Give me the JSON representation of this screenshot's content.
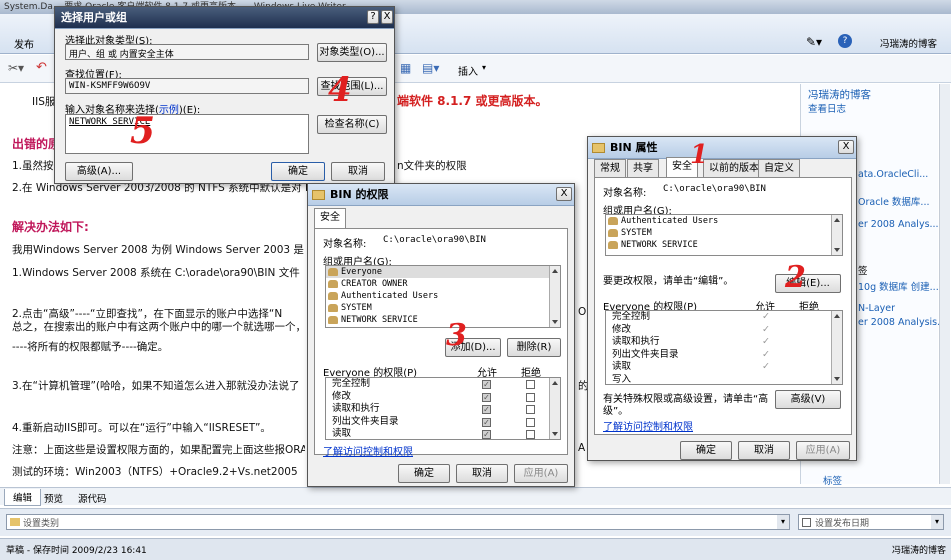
{
  "app": {
    "titlebar": "System.Da...                 要求 Oracle 客户端软件 8.1.7 或更高版本。 - Windows Live Writer",
    "publish": "发布",
    "insert": "插入",
    "blog_name": "冯瑞涛的博客",
    "status": "草稿 - 保存时间 2009/2/23 16:41",
    "status_user": "冯瑞涛的博客"
  },
  "document": {
    "iis": "IIS服",
    "headline_red": "端软件 8.1.7 或更高版本。",
    "err_head": "出错的原",
    "l1": "1.虽然按",
    "l1b": "n文件夹的权限",
    "l2": "2.在  Windows Server 2003/2008 的 NTFS 系统中默认是对 IUSR 账号权限的限制，因此我们没有权限访问该目录",
    "sol_head": "解决办法如下:",
    "p1": "我用Windows Server 2008 为例 Windows Server 2003 是",
    "p2": "1.Windows Server 2008 系统在  C:\\orade\\ora90\\BIN 文件",
    "p3": "2.点击“高级”----“立即查找”，在下面显示的账户中选择“N",
    "p3b": "总之，在搜索出的账户中有这两个账户中的哪一个就选哪一个，回",
    "p4": "----将所有的权限都赋予----确定。",
    "p5": "3.在“计算机管理”(哈哈，如果不知道怎么进入那就没办法说了",
    "p5b": "的",
    "p6": "4.重新启动IIS即可。可以在“运行”中输入“IISRESET”。",
    "p7": "注意：上面这些是设置权限方面的，如果配置完上面这些报ORA-",
    "p8": "测试的环境：Win2003（NTFS）+Oracle9.2+Vs.net2005",
    "frag_or": "OR",
    "frag_a": "A"
  },
  "sidebar": {
    "blog": "冯瑞涛的博客",
    "view_log": "查看日志",
    "items": [
      "ata.OracleCli...",
      "Oracle 数据库...",
      "er 2008 Analys...",
      "签",
      "10g 数据库 创建...",
      "N-Layer",
      "er 2008 Analysis...",
      "标签"
    ]
  },
  "bottom": {
    "tabs": [
      "编辑",
      "预览",
      "源代码"
    ],
    "category": "设置类别",
    "date": "设置发布日期"
  },
  "select_dlg": {
    "title": "选择用户或组",
    "help": "?",
    "close": "X",
    "obj_type_label": "选择此对象类型(S):",
    "obj_type_value": "用户、组 或 内置安全主体",
    "obj_type_btn": "对象类型(O)...",
    "loc_label": "查找位置(F):",
    "loc_value": "WIN-KSMFF9W6O9V",
    "loc_btn": "查找范围(L)...",
    "name_label": "输入对象名称来选择(",
    "name_link": "示例",
    "name_label_end": ")(E):",
    "name_value": "NETWORK SERVICE",
    "check_btn": "检查名称(C)",
    "adv_btn": "高级(A)...",
    "ok": "确定",
    "cancel": "取消"
  },
  "bin_perm": {
    "title": "BIN 的权限",
    "close": "X",
    "tab": "安全",
    "obj_label": "对象名称:",
    "obj_value": "C:\\oracle\\ora90\\BIN",
    "group_label": "组或用户名(G):",
    "users": [
      "Everyone",
      "CREATOR OWNER",
      "Authenticated Users",
      "SYSTEM",
      "NETWORK SERVICE"
    ],
    "add": "添加(D)...",
    "remove": "删除(R)",
    "perm_label": "Everyone 的权限(P)",
    "allow": "允许",
    "deny": "拒绝",
    "perms": [
      "完全控制",
      "修改",
      "读取和执行",
      "列出文件夹目录",
      "读取"
    ],
    "link": "了解访问控制和权限",
    "ok": "确定",
    "cancel": "取消",
    "apply": "应用(A)"
  },
  "bin_prop": {
    "title": "BIN 属性",
    "close": "X",
    "tabs": [
      "常规",
      "共享",
      "安全",
      "以前的版本",
      "自定义"
    ],
    "obj_label": "对象名称:",
    "obj_value": "C:\\oracle\\ora90\\BIN",
    "group_label": "组或用户名(G):",
    "users": [
      "Authenticated Users",
      "SYSTEM",
      "NETWORK SERVICE"
    ],
    "change_text": "要更改权限，请单击“编辑”。",
    "edit": "编辑(E)...",
    "perm_label": "Everyone 的权限(P)",
    "allow": "允许",
    "deny": "拒绝",
    "perms": [
      "完全控制",
      "修改",
      "读取和执行",
      "列出文件夹目录",
      "读取",
      "写入"
    ],
    "special_text1": "有关特殊权限或高级设置，请单击“高",
    "special_text2": "级”。",
    "advanced": "高级(V)",
    "link": "了解访问控制和权限",
    "ok": "确定",
    "cancel": "取消",
    "apply": "应用(A)"
  },
  "annotations": {
    "n1": "1",
    "n2": "2",
    "n3": "3",
    "n4": "4",
    "n5": "5"
  }
}
